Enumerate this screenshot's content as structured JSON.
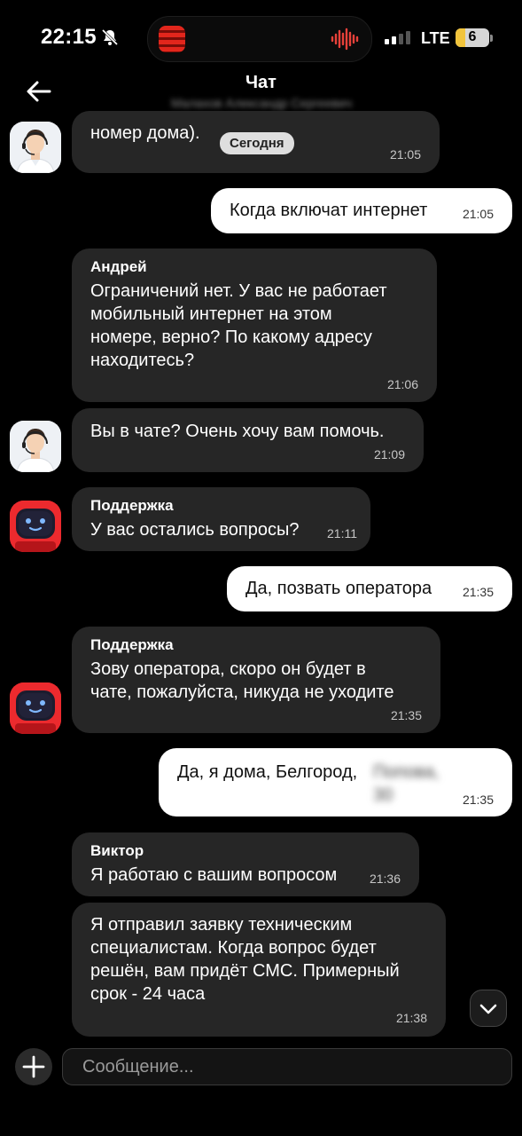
{
  "status_bar": {
    "time": "22:15",
    "network": "LTE",
    "battery": "6",
    "icons": [
      "bell-muted-icon",
      "sound-wave-icon",
      "signal-icon"
    ]
  },
  "header": {
    "title": "Чат",
    "subtitle": "Малахов Александр Сергеевич"
  },
  "date_chip": "Сегодня",
  "messages": [
    {
      "direction": "in",
      "avatar": "operator",
      "sender": "",
      "text": "номер дома).",
      "time": "21:05"
    },
    {
      "direction": "out",
      "text": "Когда включат интернет",
      "time": "21:05"
    },
    {
      "direction": "in",
      "avatar": "none",
      "sender": "Андрей",
      "text": "Ограничений нет. У вас не работает\nмобильный интернет на этом\nномере, верно? По какому адресу\nнаходитесь?",
      "time": "21:06"
    },
    {
      "direction": "in",
      "avatar": "operator",
      "sender": "",
      "text": "Вы в чате? Очень хочу вам помочь.",
      "time": "21:09"
    },
    {
      "direction": "in",
      "avatar": "robot",
      "sender": "Поддержка",
      "text": "У вас остались вопросы?",
      "time": "21:11"
    },
    {
      "direction": "out",
      "text": "Да, позвать оператора",
      "time": "21:35"
    },
    {
      "direction": "in",
      "avatar": "robot",
      "sender": "Поддержка",
      "text": "Зову оператора, скоро он будет в\nчате, пожалуйста, никуда не уходите",
      "time": "21:35"
    },
    {
      "direction": "out",
      "text": "Да, я дома, Белгород,",
      "text_blurred": "Попова,\n30",
      "time": "21:35"
    },
    {
      "direction": "in",
      "avatar": "none",
      "sender": "Виктор",
      "text": "Я работаю с вашим вопросом",
      "time": "21:36"
    },
    {
      "direction": "in",
      "avatar": "none",
      "sender": "",
      "text": "Я отправил заявку техническим\nспециалистам. Когда вопрос будет\nрешён, вам придёт СМС. Примерный\nсрок - 24 часа",
      "time": "21:38"
    }
  ],
  "composer": {
    "placeholder": "Сообщение...",
    "value": ""
  },
  "colors": {
    "background": "#000000",
    "incoming_bubble": "#262626",
    "outgoing_bubble": "#ffffff",
    "robot_avatar": "#ec2a2e",
    "battery_fill": "#f1c43c"
  }
}
